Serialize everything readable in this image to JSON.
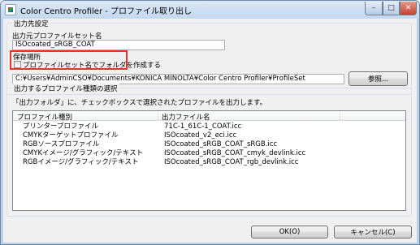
{
  "window": {
    "title": "Color Centro Profiler - プロファイル取り出し",
    "min_glyph": "–",
    "max_glyph": "□",
    "close_glyph": "✕"
  },
  "output_dest": {
    "group_title": "出力先設定",
    "set_name_label": "出力元プロファイルセット名",
    "set_name_value": "ISOcoated_sRGB_COAT",
    "save_location_label": "保存場所",
    "create_folder_label": "プロファイルセット名でフォルダを作成する",
    "create_folder_checked": false,
    "path_value": "C:¥Users¥AdminCSO¥Documents¥KONICA MINOLTA¥Color Centro Profiler¥ProfileSet",
    "browse_label": "参照..."
  },
  "profile_select": {
    "group_title": "出力するプロファイル種類の選択",
    "description": "「出力フォルダ」に、チェックボックスで選択されたプロファイルを出力します。",
    "columns": [
      "プロファイル種別",
      "出力ファイル名"
    ],
    "rows": [
      {
        "type": "プリンタープロファイル",
        "file": "71C-1_61C-1_COAT.icc"
      },
      {
        "type": "CMYKターゲットプロファイル",
        "file": "ISOcoated_v2_eci.icc"
      },
      {
        "type": "RGBソースプロファイル",
        "file": "ISOcoated_sRGB_COAT_sRGB.icc"
      },
      {
        "type": "CMYKイメージ/グラフィック/テキスト",
        "file": "ISOcoated_sRGB_COAT_cmyk_devlink.icc"
      },
      {
        "type": "RGBイメージ/グラフィック/テキスト",
        "file": "ISOcoated_sRGB_COAT_rgb_devlink.icc"
      }
    ]
  },
  "footer": {
    "ok_label": "OK(O)",
    "cancel_label": "キャンセル(C)"
  },
  "colors": {
    "highlight": "#e8332a",
    "window_frame": "#b9d1ea",
    "dialog_bg": "#f0f0f0"
  }
}
